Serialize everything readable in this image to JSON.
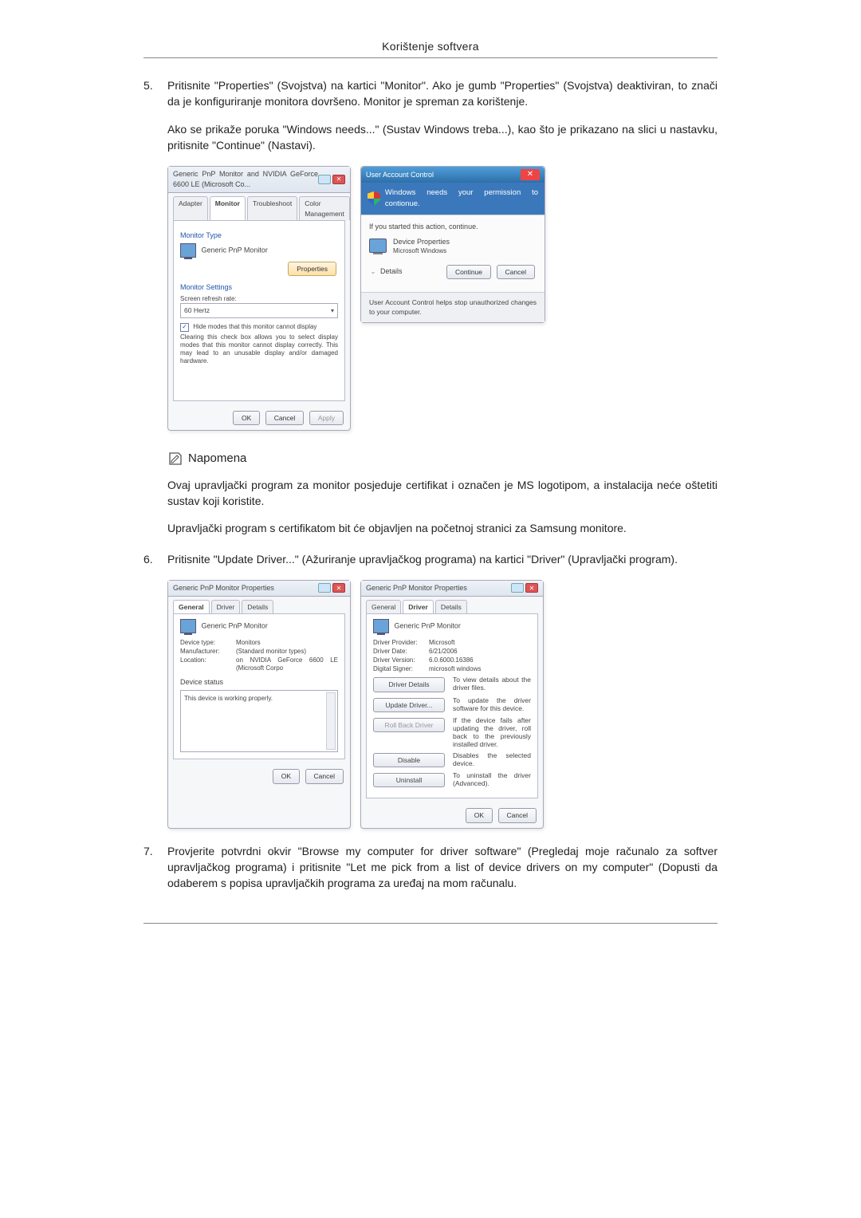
{
  "header": {
    "title": "Korištenje softvera"
  },
  "step5": {
    "num": "5.",
    "text": "Pritisnite \"Properties\" (Svojstva) na kartici \"Monitor\". Ako je gumb \"Properties\" (Svojstva) deaktiviran, to znači da je konfiguriranje monitora dovršeno. Monitor je spreman za korištenje.",
    "text2": "Ako se prikaže poruka \"Windows needs...\" (Sustav Windows treba...), kao što je prikazano na slici u nastavku, pritisnite \"Continue\" (Nastavi)."
  },
  "step6": {
    "num": "6.",
    "text": "Pritisnite \"Update Driver...\" (Ažuriranje upravljačkog programa) na kartici \"Driver\" (Upravljački program)."
  },
  "step7": {
    "num": "7.",
    "text": "Provjerite potvrdni okvir \"Browse my computer for driver software\" (Pregledaj moje računalo za softver upravljačkog programa) i pritisnite \"Let me pick from a list of device drivers on my computer\" (Dopusti da odaberem s popisa upravljačkih programa za uređaj na mom računalu."
  },
  "note": {
    "heading": "Napomena",
    "p1": "Ovaj upravljački program za monitor posjeduje certifikat i označen je MS logotipom, a instalacija neće oštetiti sustav koji koristite.",
    "p2": "Upravljački program s certifikatom bit će objavljen na početnoj stranici za Samsung monitore."
  },
  "winA": {
    "title": "Generic PnP Monitor and NVIDIA GeForce 6600 LE (Microsoft Co...",
    "tabs": [
      "Adapter",
      "Monitor",
      "Troubleshoot",
      "Color Management"
    ],
    "active_tab": "Monitor",
    "monitor_type_label": "Monitor Type",
    "monitor_type_value": "Generic PnP Monitor",
    "properties_btn": "Properties",
    "settings_label": "Monitor Settings",
    "refresh_label": "Screen refresh rate:",
    "refresh_value": "60 Hertz",
    "hide_modes_checkbox": "Hide modes that this monitor cannot display",
    "hide_modes_desc": "Clearing this check box allows you to select display modes that this monitor cannot display correctly. This may lead to an unusable display and/or damaged hardware.",
    "ok": "OK",
    "cancel": "Cancel",
    "apply": "Apply"
  },
  "uac": {
    "title": "User Account Control",
    "banner": "Windows needs your permission to contionue.",
    "started": "If you started this action, continue.",
    "prog": "Device Properties",
    "pub": "Microsoft Windows",
    "details": "Details",
    "continue": "Continue",
    "cancel": "Cancel",
    "footer": "User Account Control helps stop unauthorized changes to your computer."
  },
  "winB": {
    "title": "Generic PnP Monitor Properties",
    "tabs": [
      "General",
      "Driver",
      "Details"
    ],
    "active_tab": "General",
    "name": "Generic PnP Monitor",
    "device_type_l": "Device type:",
    "device_type_v": "Monitors",
    "manufacturer_l": "Manufacturer:",
    "manufacturer_v": "(Standard monitor types)",
    "location_l": "Location:",
    "location_v": "on NVIDIA GeForce 6600 LE (Microsoft Corpo",
    "device_status_l": "Device status",
    "device_status_v": "This device is working properly.",
    "ok": "OK",
    "cancel": "Cancel"
  },
  "winC": {
    "title": "Generic PnP Monitor Properties",
    "tabs": [
      "General",
      "Driver",
      "Details"
    ],
    "active_tab": "Driver",
    "name": "Generic PnP Monitor",
    "provider_l": "Driver Provider:",
    "provider_v": "Microsoft",
    "date_l": "Driver Date:",
    "date_v": "6/21/2006",
    "version_l": "Driver Version:",
    "version_v": "6.0.6000.16386",
    "signer_l": "Digital Signer:",
    "signer_v": "microsoft windows",
    "btn_details": "Driver Details",
    "btn_details_d": "To view details about the driver files.",
    "btn_update": "Update Driver...",
    "btn_update_d": "To update the driver software for this device.",
    "btn_rollback": "Roll Back Driver",
    "btn_rollback_d": "If the device fails after updating the driver, roll back to the previously installed driver.",
    "btn_disable": "Disable",
    "btn_disable_d": "Disables the selected device.",
    "btn_uninstall": "Uninstall",
    "btn_uninstall_d": "To uninstall the driver (Advanced).",
    "ok": "OK",
    "cancel": "Cancel"
  }
}
